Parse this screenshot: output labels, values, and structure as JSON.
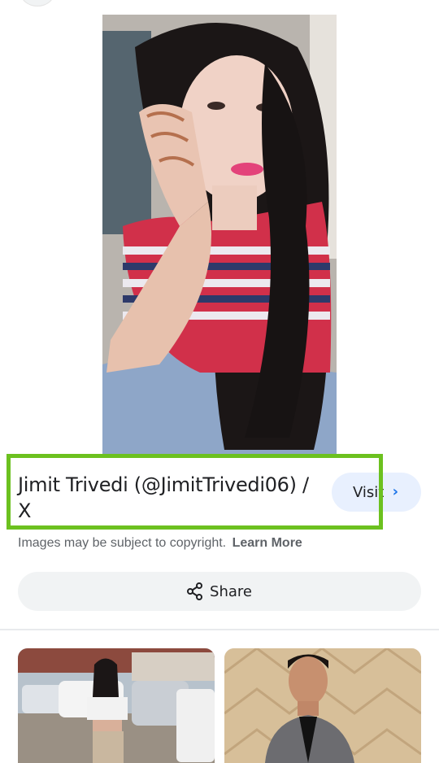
{
  "result": {
    "title": "Jimit Trivedi (@JimitTrivedi06) / X",
    "visit_label": "Visit",
    "visit_chevron": "›"
  },
  "copyright": {
    "notice": "Images may be subject to copyright.",
    "learn_more": "Learn More"
  },
  "share": {
    "label": "Share"
  },
  "colors": {
    "highlight_border": "#6cc11f",
    "visit_bg": "#e8f0fe",
    "share_bg": "#f1f3f4",
    "link_blue": "#1a73e8"
  }
}
